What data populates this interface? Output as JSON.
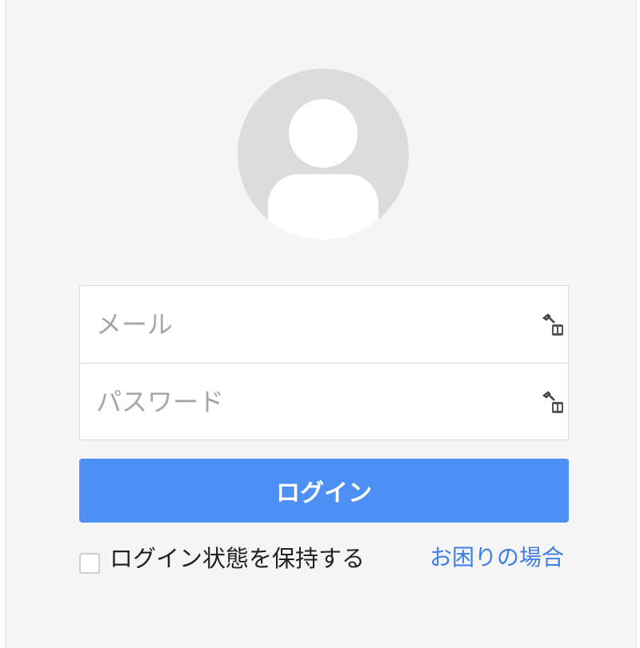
{
  "login_form": {
    "avatar_icon": "user-avatar-icon",
    "email": {
      "value": "",
      "placeholder": "メール",
      "icon": "key-icon"
    },
    "password": {
      "value": "",
      "placeholder": "パスワード",
      "icon": "key-icon"
    },
    "login_button_label": "ログイン",
    "remember_label": "ログイン状態を保持する",
    "remember_checked": false,
    "help_link_label": "お困りの場合"
  },
  "colors": {
    "background": "#f5f5f5",
    "button": "#4d90f5",
    "link": "#3e7fe6",
    "avatar": "#dcdcdc"
  }
}
